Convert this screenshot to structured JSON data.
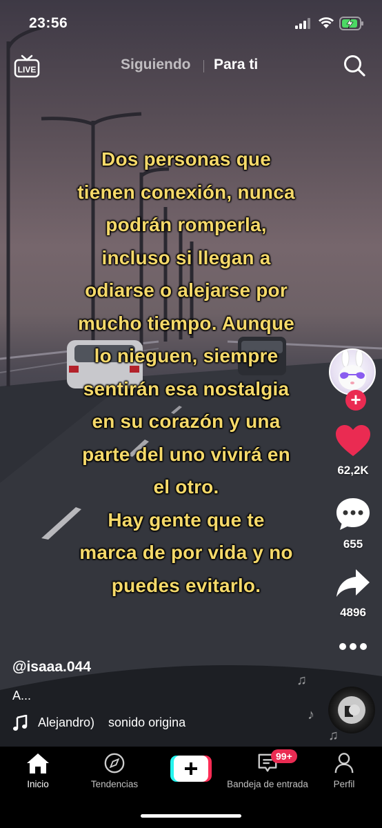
{
  "status_bar": {
    "time": "23:56",
    "battery": "charging",
    "wifi": "full",
    "signal_bars": 3
  },
  "top_nav": {
    "live_label": "LIVE",
    "tab_following": "Siguiendo",
    "tab_for_you": "Para ti",
    "active_tab": "Para ti"
  },
  "caption": "Dos personas que\ntienen conexión, nunca\npodrán romperla,\nincluso si llegan a\nodiarse o alejarse por\nmucho tiempo. Aunque\nlo nieguen, siempre\nsentirán esa nostalgia\nen su corazón y una\nparte del uno vivirá en\nel otro.\nHay gente que te\nmarca de por vida y no\npuedes evitarlo.",
  "actions": {
    "likes": "62,2K",
    "comments": "655",
    "shares": "4896",
    "follow": "+"
  },
  "post": {
    "username": "@isaaa.044",
    "description": "A...",
    "music": "Alejandro)    sonido origina"
  },
  "tab_bar": {
    "home": "Inicio",
    "discover": "Tendencias",
    "create": "+",
    "inbox": "Bandeja de entrada",
    "inbox_badge": "99+",
    "profile": "Perfil"
  },
  "colors": {
    "caption_text": "#f5d96a",
    "accent": "#ea2b52",
    "tab_bar_bg": "#000000"
  }
}
